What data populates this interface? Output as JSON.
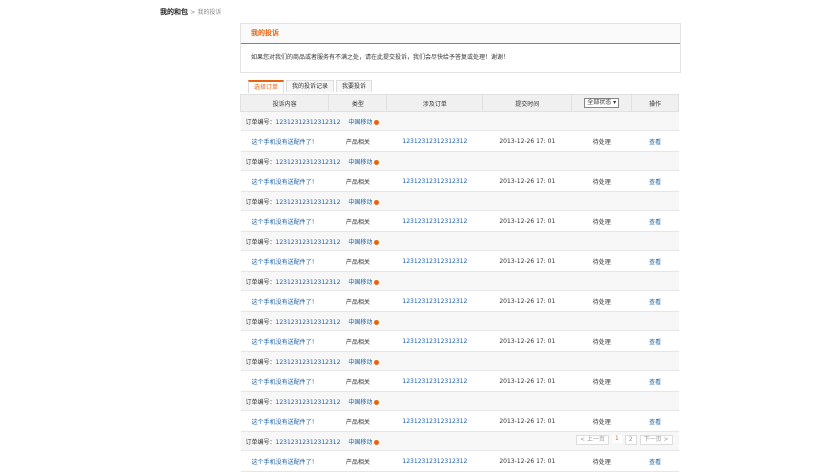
{
  "breadcrumb": {
    "home": "我的和包",
    "sep": ">",
    "current": "我的投诉"
  },
  "panel": {
    "title": "我的投诉",
    "notice": "如果您对我们的商品或者服务有不满之处，请在此提交投诉，我们会尽快给予答复或处理！谢谢！"
  },
  "tabs": [
    "选择订单",
    "我的投诉记录",
    "我要投诉"
  ],
  "table": {
    "headers": [
      "投诉内容",
      "类型",
      "涉及订单",
      "提交时间",
      "全部状态",
      "操作"
    ],
    "order_label": "订单编号：",
    "orders": [
      {
        "order_no": "12312312312312312",
        "carrier": "中国移动",
        "content": "这个手机没有送配件了！",
        "type": "产品相关",
        "related_order": "12312312312312312",
        "time": "2013-12-26 17: 01",
        "status": "待处理",
        "action": "查看"
      },
      {
        "order_no": "12312312312312312",
        "carrier": "中国移动",
        "content": "这个手机没有送配件了！",
        "type": "产品相关",
        "related_order": "12312312312312312",
        "time": "2013-12-26 17: 01",
        "status": "待处理",
        "action": "查看"
      },
      {
        "order_no": "12312312312312312",
        "carrier": "中国移动",
        "content": "这个手机没有送配件了！",
        "type": "产品相关",
        "related_order": "12312312312312312",
        "time": "2013-12-26 17: 01",
        "status": "待处理",
        "action": "查看"
      },
      {
        "order_no": "12312312312312312",
        "carrier": "中国移动",
        "content": "这个手机没有送配件了！",
        "type": "产品相关",
        "related_order": "12312312312312312",
        "time": "2013-12-26 17: 01",
        "status": "待处理",
        "action": "查看"
      },
      {
        "order_no": "12312312312312312",
        "carrier": "中国移动",
        "content": "这个手机没有送配件了！",
        "type": "产品相关",
        "related_order": "12312312312312312",
        "time": "2013-12-26 17: 01",
        "status": "待处理",
        "action": "查看"
      },
      {
        "order_no": "12312312312312312",
        "carrier": "中国移动",
        "content": "这个手机没有送配件了！",
        "type": "产品相关",
        "related_order": "12312312312312312",
        "time": "2013-12-26 17: 01",
        "status": "待处理",
        "action": "查看"
      },
      {
        "order_no": "12312312312312312",
        "carrier": "中国移动",
        "content": "这个手机没有送配件了！",
        "type": "产品相关",
        "related_order": "12312312312312312",
        "time": "2013-12-26 17: 01",
        "status": "待处理",
        "action": "查看"
      },
      {
        "order_no": "12312312312312312",
        "carrier": "中国移动",
        "content": "这个手机没有送配件了！",
        "type": "产品相关",
        "related_order": "12312312312312312",
        "time": "2013-12-26 17: 01",
        "status": "待处理",
        "action": "查看"
      },
      {
        "order_no": "12312312312312312",
        "carrier": "中国移动",
        "content": "这个手机没有送配件了！",
        "type": "产品相关",
        "related_order": "12312312312312312",
        "time": "2013-12-26 17: 01",
        "status": "待处理",
        "action": "查看"
      }
    ]
  },
  "pager": {
    "prev": "< 上一页",
    "pages": [
      "1",
      "2"
    ],
    "next": "下一页 >"
  },
  "colors": {
    "accent": "#e8630c",
    "link": "#1a5fa6"
  }
}
